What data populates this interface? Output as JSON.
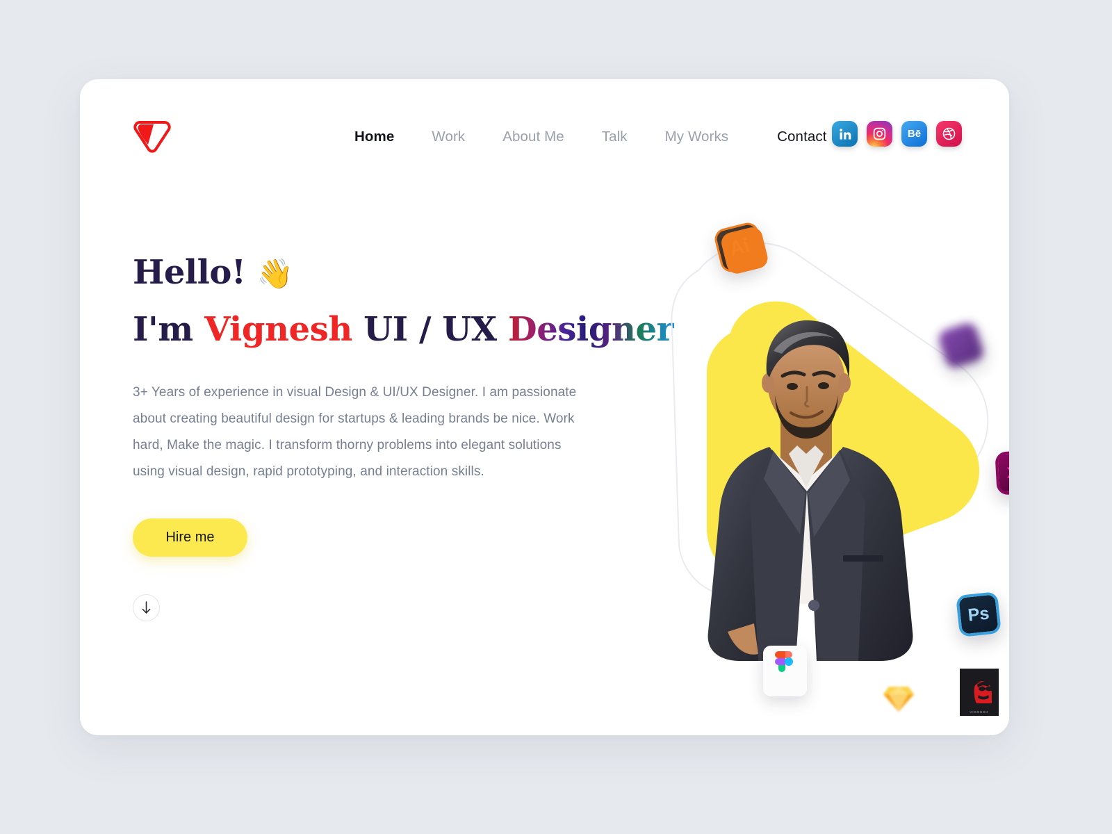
{
  "page": {
    "background_color": "#e6e9ee",
    "card_color": "#ffffff",
    "accent_yellow": "#fbe94f",
    "ink": "#251c4a"
  },
  "header": {
    "logo_name": "vignesh-logo",
    "nav": [
      {
        "label": "Home",
        "active": true,
        "style": "underline"
      },
      {
        "label": "Work",
        "active": false,
        "style": "plain"
      },
      {
        "label": "About Me",
        "active": false,
        "style": "plain"
      },
      {
        "label": "Talk",
        "active": false,
        "style": "plain"
      },
      {
        "label": "My Works",
        "active": false,
        "style": "plain"
      },
      {
        "label": "Contact",
        "active": false,
        "style": "pill"
      }
    ],
    "socials": [
      {
        "name": "linkedin",
        "glyph": "in",
        "color": "#0a71b0"
      },
      {
        "name": "instagram",
        "glyph": "◎",
        "color": "#cf2e92"
      },
      {
        "name": "behance",
        "glyph": "Bē",
        "color": "#0d6fd6"
      },
      {
        "name": "dribbble",
        "glyph": "◎",
        "color": "#d2104a"
      }
    ]
  },
  "hero": {
    "greeting": "Hello!",
    "wave_emoji": "👋",
    "line2_prefix": "I'm ",
    "name": "Vignesh",
    "line2_mid": " UI / UX ",
    "role": "Designer",
    "paragraph": "3+ Years of experience in visual Design & UI/UX Designer. I am passionate about creating beautiful design for startups & leading brands be nice. Work hard, Make the magic. I transform thorny problems into elegant solutions using visual design, rapid prototyping, and interaction skills.",
    "cta_label": "Hire me",
    "scroll_icon": "arrow-down-icon"
  },
  "artwork": {
    "blob_color": "#fbe74a",
    "outline_color": "#e8eaee",
    "portrait_alt": "portrait-photo",
    "tools": [
      {
        "name": "adobe-illustrator",
        "label": "Ai"
      },
      {
        "name": "blurred-app",
        "label": ""
      },
      {
        "name": "adobe-xd",
        "label": "XD"
      },
      {
        "name": "adobe-photoshop",
        "label": "Ps"
      },
      {
        "name": "figma",
        "label": ""
      },
      {
        "name": "sketch",
        "label": ""
      }
    ]
  },
  "badge": {
    "name": "VIGNESH"
  }
}
